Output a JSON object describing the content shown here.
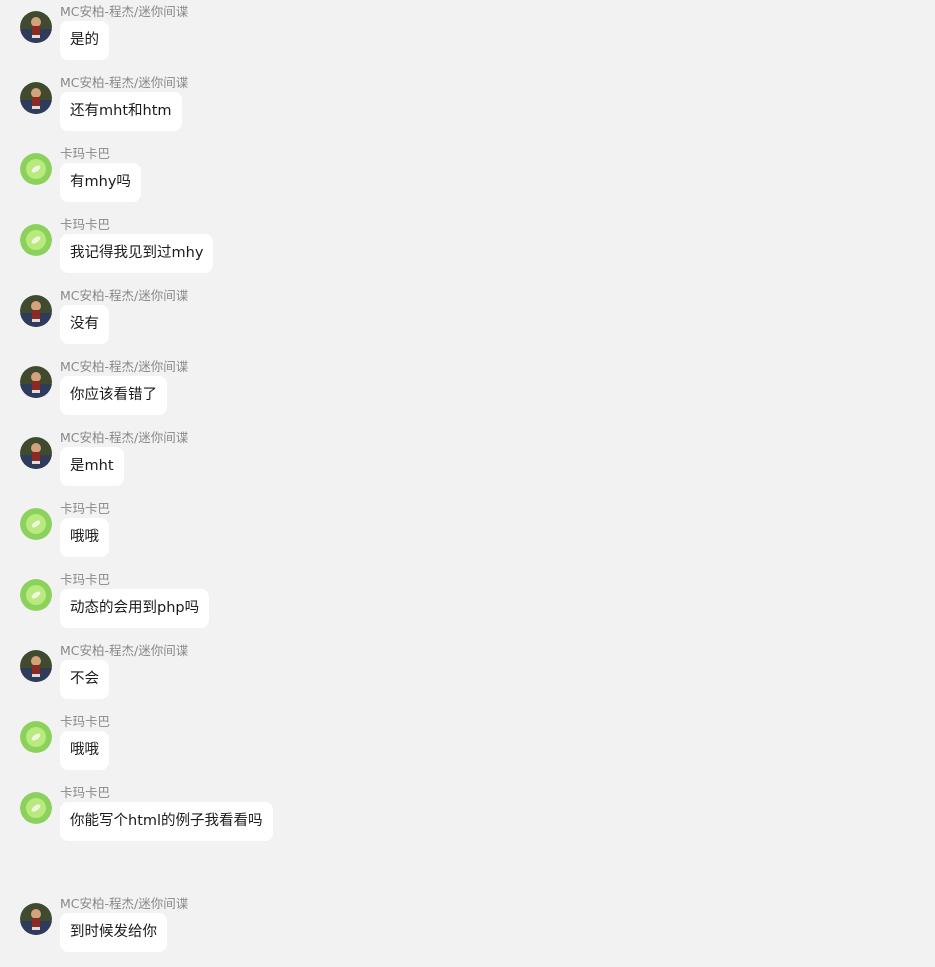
{
  "messages": [
    {
      "sender": "MC安柏-程杰/迷你间谍",
      "avatar": "dark-character-avatar",
      "text": "是的"
    },
    {
      "sender": "MC安柏-程杰/迷你间谍",
      "avatar": "dark-character-avatar",
      "text": "还有mht和htm"
    },
    {
      "sender": "卡玛卡巴",
      "avatar": "green-leaf-avatar",
      "text": "有mhy吗"
    },
    {
      "sender": "卡玛卡巴",
      "avatar": "green-leaf-avatar",
      "text": "我记得我见到过mhy"
    },
    {
      "sender": "MC安柏-程杰/迷你间谍",
      "avatar": "dark-character-avatar",
      "text": "没有"
    },
    {
      "sender": "MC安柏-程杰/迷你间谍",
      "avatar": "dark-character-avatar",
      "text": "你应该看错了"
    },
    {
      "sender": "MC安柏-程杰/迷你间谍",
      "avatar": "dark-character-avatar",
      "text": "是mht"
    },
    {
      "sender": "卡玛卡巴",
      "avatar": "green-leaf-avatar",
      "text": "哦哦"
    },
    {
      "sender": "卡玛卡巴",
      "avatar": "green-leaf-avatar",
      "text": "动态的会用到php吗"
    },
    {
      "sender": "MC安柏-程杰/迷你间谍",
      "avatar": "dark-character-avatar",
      "text": "不会"
    },
    {
      "sender": "卡玛卡巴",
      "avatar": "green-leaf-avatar",
      "text": "哦哦"
    },
    {
      "sender": "卡玛卡巴",
      "avatar": "green-leaf-avatar",
      "text": "你能写个html的例子我看看吗"
    },
    {
      "sender": "MC安柏-程杰/迷你间谍",
      "avatar": "dark-character-avatar",
      "text": "到时候发给你"
    }
  ],
  "colors": {
    "background": "#f2f2f2",
    "bubble": "#ffffff",
    "sender_text": "#888888",
    "message_text": "#1a1a1a"
  }
}
